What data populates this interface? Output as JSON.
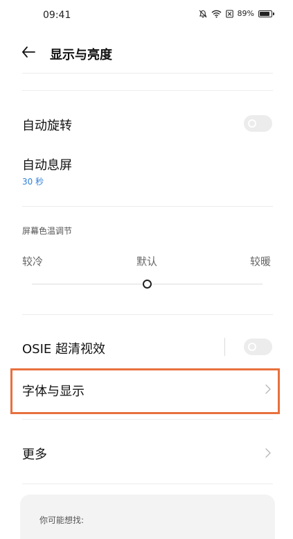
{
  "status_bar": {
    "time": "09:41",
    "battery_text": "89%",
    "battery_level": 0.89,
    "icons": [
      "bell-mute-icon",
      "wifi-icon",
      "sim-x-icon",
      "battery-icon"
    ]
  },
  "header": {
    "title": "显示与亮度",
    "back_icon": "arrow-left-icon"
  },
  "settings": {
    "auto_rotate": {
      "label": "自动旋转",
      "enabled": false
    },
    "auto_screen_off": {
      "label": "自动息屏",
      "value": "30 秒"
    },
    "color_temp": {
      "title": "屏幕色温调节",
      "cool": "较冷",
      "default": "默认",
      "warm": "较暖",
      "level": 0.5
    },
    "osie": {
      "label": "OSIE 超清视效",
      "enabled": false
    },
    "font_display": {
      "label": "字体与显示"
    },
    "more": {
      "label": "更多"
    }
  },
  "suggestions": {
    "title": "你可能想找:"
  },
  "colors": {
    "accent_blue": "#2f7fd8",
    "highlight": "#e8703d",
    "toggle_off": "#ececec"
  }
}
